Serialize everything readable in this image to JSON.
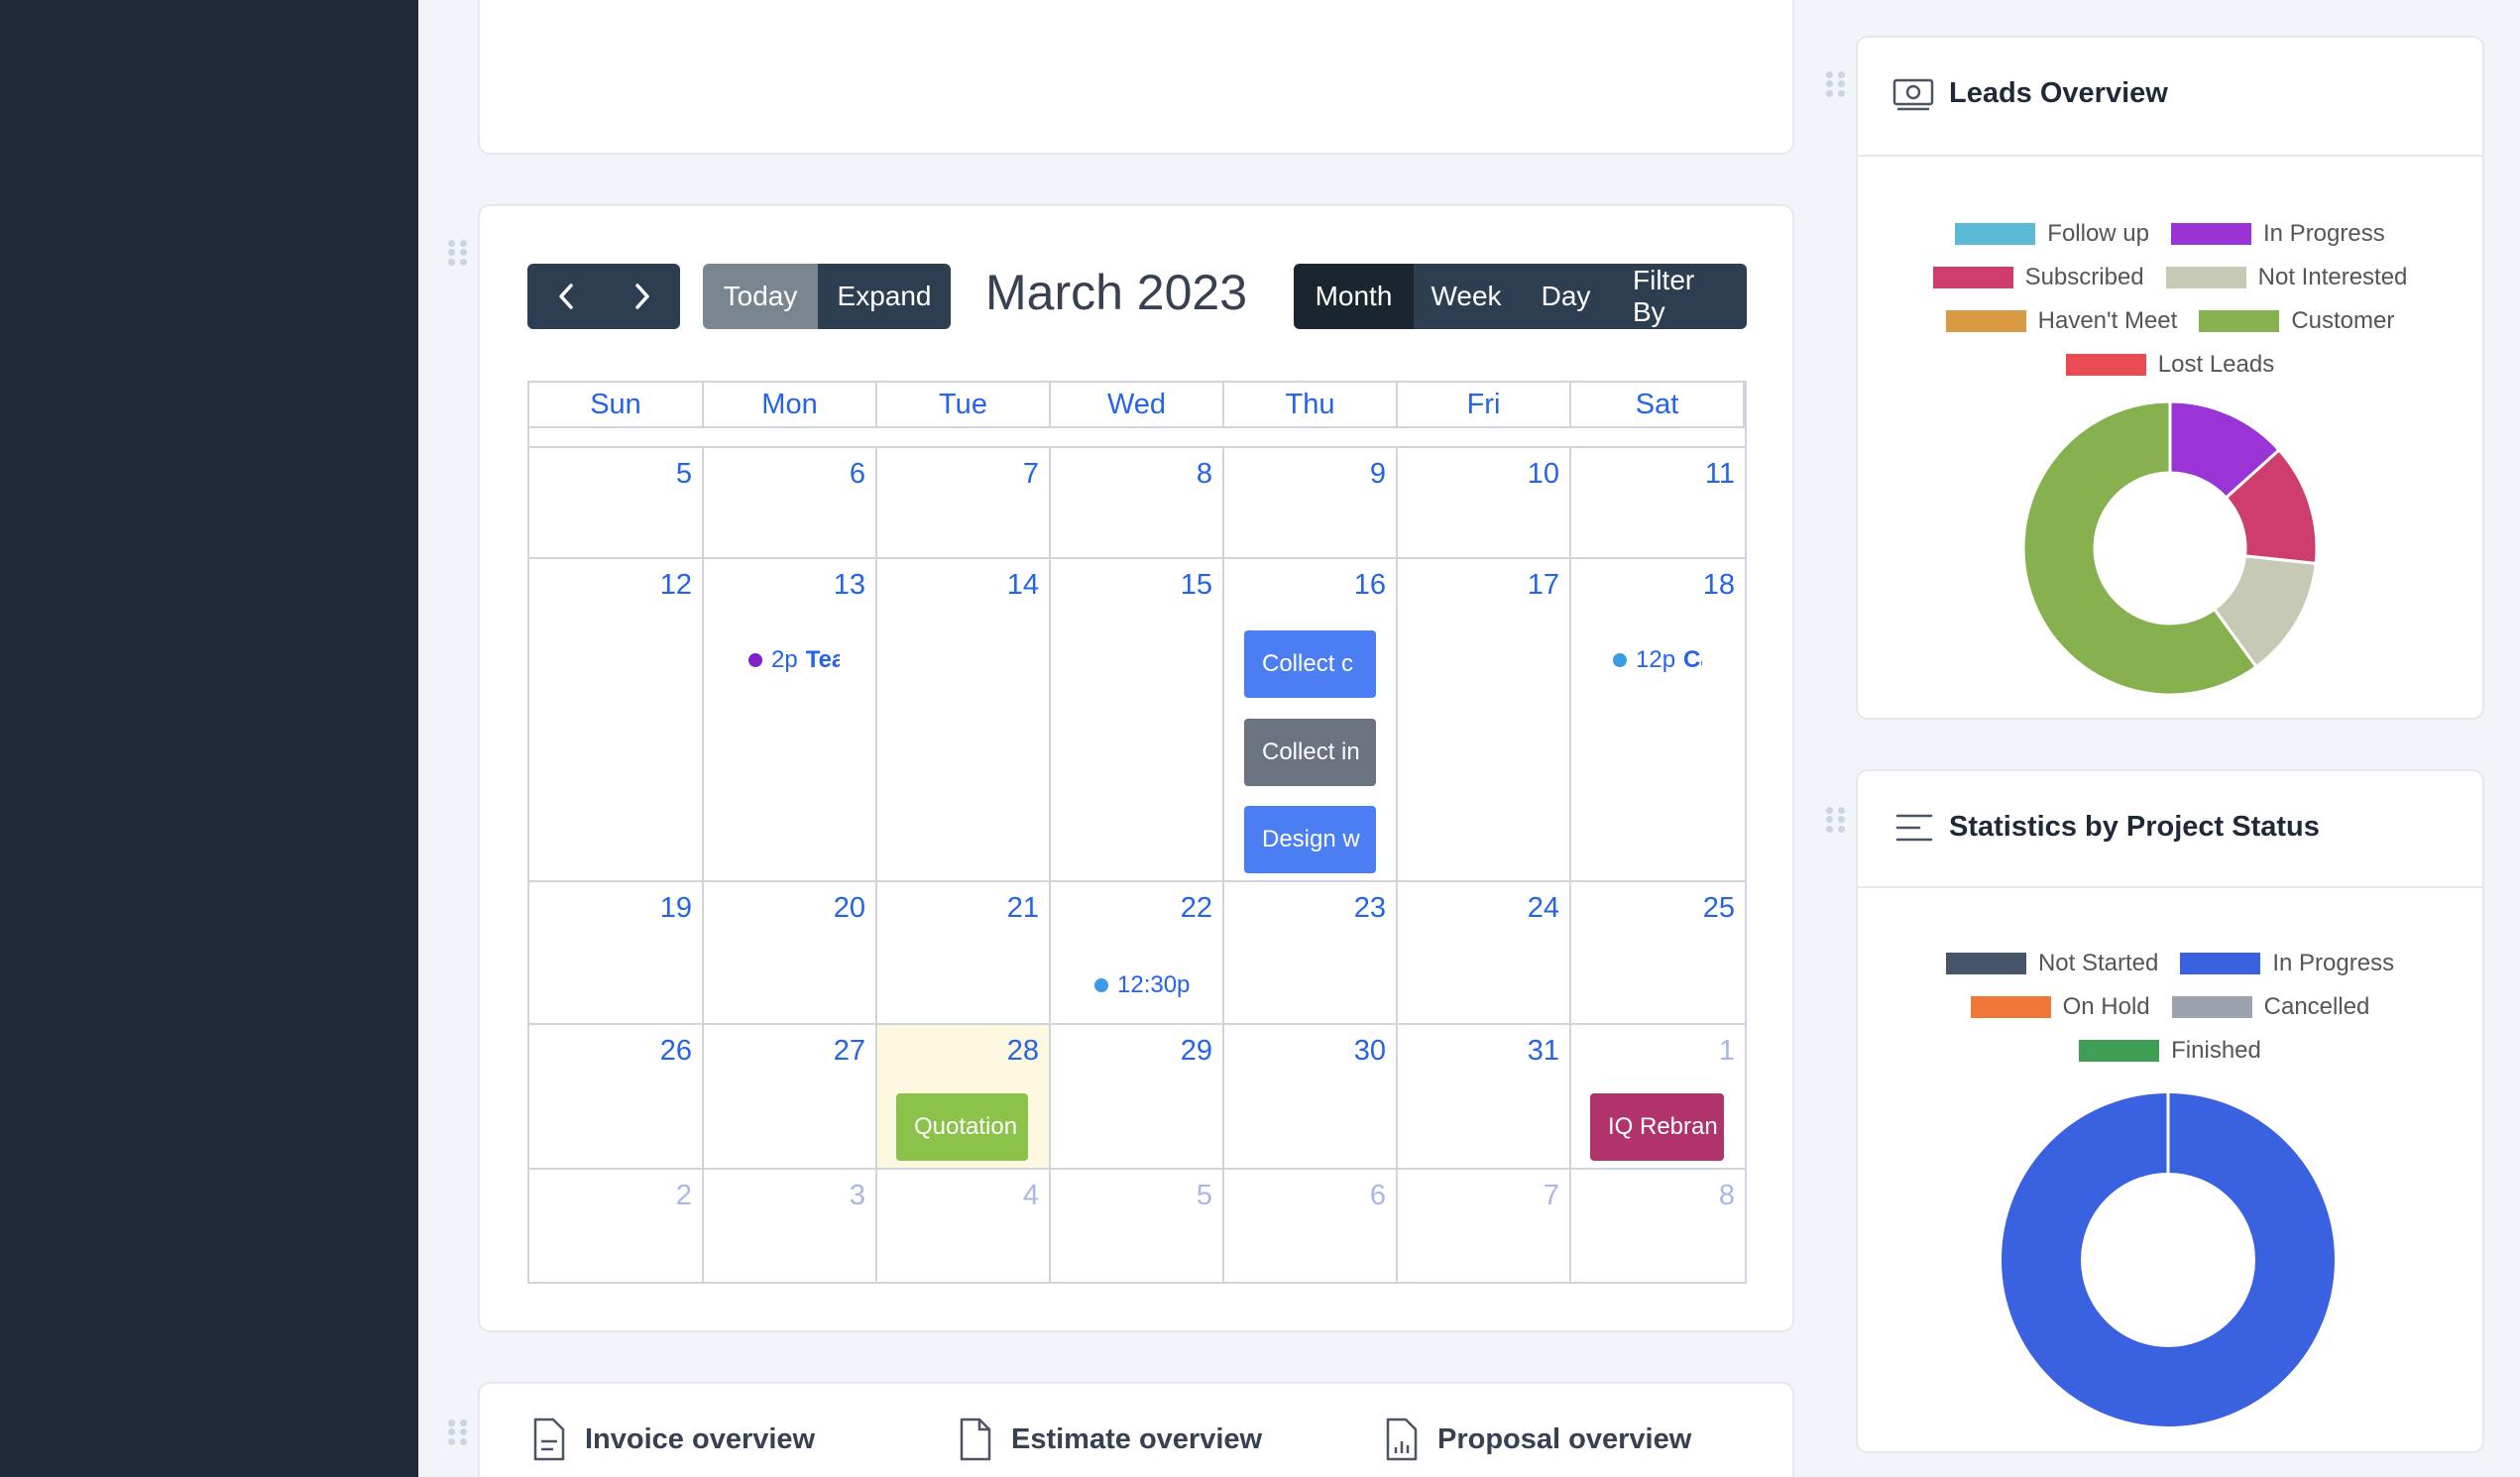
{
  "calendar": {
    "title": "March 2023",
    "today_label": "Today",
    "expand_label": "Expand",
    "views": [
      "Month",
      "Week",
      "Day",
      "Filter By"
    ],
    "weekdays": [
      "Sun",
      "Mon",
      "Tue",
      "Wed",
      "Thu",
      "Fri",
      "Sat"
    ],
    "weeks": [
      [
        "5",
        "6",
        "7",
        "8",
        "9",
        "10",
        "11"
      ],
      [
        "12",
        "13",
        "14",
        "15",
        "16",
        "17",
        "18"
      ],
      [
        "19",
        "20",
        "21",
        "22",
        "23",
        "24",
        "25"
      ],
      [
        "26",
        "27",
        "28",
        "29",
        "30",
        "31",
        "1"
      ],
      [
        "2",
        "3",
        "4",
        "5",
        "6",
        "7",
        "8"
      ]
    ],
    "events": {
      "mon13_time": "2p",
      "mon13_title": "Tea",
      "sat18_time": "12p",
      "sat18_title": "Ca",
      "thu16_a": "Collect c",
      "thu16_b": "Collect in",
      "thu16_c": "Design w",
      "wed22_time": "12:30p",
      "tue28": "Quotation",
      "sat1": "IQ Rebran"
    },
    "colors": {
      "accent_blue": "#4c7ef3",
      "gray_event": "#6b7280",
      "green_event": "#8bc34a",
      "magenta_event": "#b0336b",
      "purple_dot": "#7e22ce",
      "blue_dot": "#3b9be6",
      "today_bg": "#fff8e1"
    }
  },
  "leads": {
    "title": "Leads Overview",
    "legend": [
      {
        "label": "Follow up",
        "color": "#5bbad5"
      },
      {
        "label": "In Progress",
        "color": "#9b34d6"
      },
      {
        "label": "Subscribed",
        "color": "#cf3d6e"
      },
      {
        "label": "Not Interested",
        "color": "#c6c9b4"
      },
      {
        "label": "Haven't Meet",
        "color": "#d99a42"
      },
      {
        "label": "Customer",
        "color": "#86b14e"
      },
      {
        "label": "Lost Leads",
        "color": "#ea4a52"
      }
    ]
  },
  "project_stats": {
    "title": "Statistics by Project Status",
    "legend": [
      {
        "label": "Not Started",
        "color": "#475569"
      },
      {
        "label": "In Progress",
        "color": "#3961e0"
      },
      {
        "label": "On Hold",
        "color": "#ef7838"
      },
      {
        "label": "Cancelled",
        "color": "#9ca3af"
      },
      {
        "label": "Finished",
        "color": "#3f9f55"
      }
    ]
  },
  "chart_data": [
    {
      "type": "pie",
      "categories": [
        "Follow up",
        "In Progress",
        "Subscribed",
        "Not Interested",
        "Haven't Meet",
        "Customer",
        "Lost Leads"
      ],
      "values": [
        0,
        2,
        2,
        2,
        0,
        9,
        0
      ]
    },
    {
      "type": "pie",
      "categories": [
        "Not Started",
        "In Progress",
        "On Hold",
        "Cancelled",
        "Finished"
      ],
      "values": [
        0,
        1,
        0,
        0,
        0
      ]
    }
  ],
  "overviews": {
    "invoice": "Invoice overview",
    "estimate": "Estimate overview",
    "proposal": "Proposal overview"
  }
}
